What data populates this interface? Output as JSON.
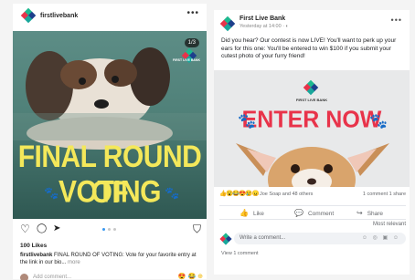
{
  "instagram": {
    "username": "firstlivebank",
    "more_icon": "ellipsis-icon",
    "more_glyph": "•••",
    "image": {
      "counter": "1/3",
      "brand": "FIRST LIVE BANK",
      "headline_line1": "FINAL ROUND OF",
      "headline_line2": "VOTING",
      "background_color": "#4f8078",
      "headline_color": "#f4e85a"
    },
    "actions": {
      "like_glyph": "♡",
      "comment_glyph": "◯",
      "share_glyph": "➤",
      "save_glyph": "⛉",
      "carousel_active": 1,
      "carousel_total": 3
    },
    "likes": "100 Likes",
    "caption": {
      "user": "firstlivebank",
      "text": " FINAL ROUND OF VOTING: Vote for your favorite entry at the link in our bio...",
      "more": " more"
    },
    "comment_placeholder": "Add comment...",
    "comment_emojis": "😍 😂 ⊕"
  },
  "facebook": {
    "page_name": "First Live Bank",
    "timestamp": "Yesterday at 14:00 · ◐",
    "more_glyph": "•••",
    "post_text": "Did you hear? Our contest is now LIVE! You'll want to perk up your ears for this one: You'll be entered to win $100 if you submit your cutest photo of your furry friend!",
    "image": {
      "brand": "FIRST LIVE BANK",
      "headline": "ENTER NOW",
      "headline_color": "#e8334a",
      "paw_color": "#2bb3a3"
    },
    "reactions": {
      "emojis": "👍😮😂😍😢😠",
      "who": "Joe Soap and 48 others",
      "counts": "1 comment 1 share"
    },
    "actions": [
      {
        "icon": "thumbs-up-icon",
        "glyph": "👍",
        "label": "Like"
      },
      {
        "icon": "comment-icon",
        "glyph": "💬",
        "label": "Comment"
      },
      {
        "icon": "share-icon",
        "glyph": "↪",
        "label": "Share"
      }
    ],
    "sort": "Most relevant",
    "write_placeholder": "Write a comment...",
    "write_tools": "☺ ◎ ▣ ☺",
    "view_comments": "View 1 comment"
  }
}
